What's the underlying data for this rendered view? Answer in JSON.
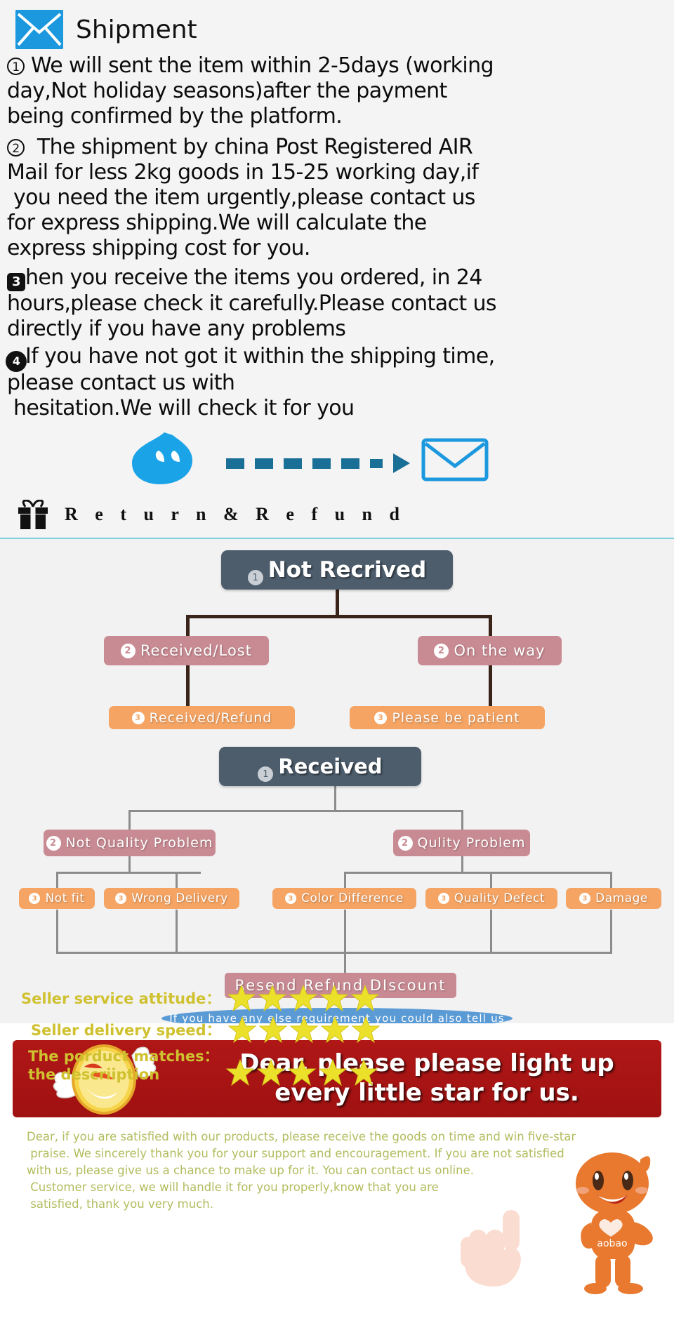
{
  "shipment": {
    "icon": "mail-icon",
    "title": "Shipment",
    "items": [
      {
        "marker": "1",
        "marker_style": "circle-outline",
        "text": "We will sent the item within 2-5days (working\nday,Not holiday seasons)after the payment\nbeing confirmed by the platform."
      },
      {
        "marker": "2",
        "marker_style": "circle-outline",
        "text": "  The shipment by china Post Registered AIR\nMail for less 2kg goods in 15-25 working day,if\n you need the item urgently,please contact us\nfor express shipping.We will calculate the\nexpress shipping cost for you."
      },
      {
        "marker": "3",
        "marker_style": "filled-square",
        "text": "hen you receive the items you ordered, in 24\nhours,please check it carefully.Please contact us\ndirectly if you have any problems"
      },
      {
        "marker": "4",
        "marker_style": "filled-circle",
        "text": "If you have not got it within the shipping time,\nplease contact us with\n hesitation.We will check it for you"
      }
    ],
    "icons_row": {
      "blob": "blue-blob-face-icon",
      "arrow": "dashed-arrow-icon",
      "envelope": "envelope-outline-icon"
    }
  },
  "return_refund": {
    "icon": "gift-icon",
    "title": "R e t u r n & R e f u n d"
  },
  "flowchart": {
    "colors": {
      "level1": "#4d5d6c",
      "level2": "#c98b93",
      "level3": "#f5a463",
      "ellipse": "#5b9bd5",
      "connector_dark": "#3a2318",
      "connector_gray": "#8c8c8c"
    },
    "tree_not_received": {
      "root": {
        "badge": "1",
        "label": "Not Recrived"
      },
      "branches": [
        {
          "badge": "2",
          "label": "Received/Lost",
          "child": {
            "badge": "3",
            "label": "Received/Refund"
          }
        },
        {
          "badge": "2",
          "label": "On  the  way",
          "child": {
            "badge": "3",
            "label": "Please  be  patient"
          }
        }
      ]
    },
    "tree_received": {
      "root": {
        "badge": "1",
        "label": "Received"
      },
      "branches": [
        {
          "badge": "2",
          "label": "Not  Quality  Problem",
          "children": [
            {
              "badge": "3",
              "label": "Not  fit"
            },
            {
              "badge": "3",
              "label": "Wrong  Delivery"
            }
          ]
        },
        {
          "badge": "2",
          "label": "Qulity  Problem",
          "children": [
            {
              "badge": "3",
              "label": "Color  Difference"
            },
            {
              "badge": "3",
              "label": "Quality  Defect"
            },
            {
              "badge": "3",
              "label": "Damage"
            }
          ]
        }
      ],
      "result": "Resend  Refund  DIscount",
      "footer_note": "If  you  have  any  else  requirement  you  could  also  tell  us"
    }
  },
  "banner": {
    "background_color": "#a81414",
    "icon": "winking-angel-emoji-icon",
    "line1": "Dear, please please light up",
    "line2": "every little star for us."
  },
  "praise": {
    "text": "Dear, if you are satisfied with our products, please receive the goods on time and win five-star\n praise. We sincerely thank you for your support and encouragement. If you are not satisfied\nwith us, please give us a chance to make up for it. You can contact us online.\n Customer service, we will handle it for you properly,know that you are\n satisfied, thank you very much.",
    "color": "#b3bc5e"
  },
  "ratings": [
    {
      "label": "Seller service attitude：",
      "stars": 5
    },
    {
      "label": "Seller delivery speed：",
      "stars": 5
    },
    {
      "label": "The porduct matches：",
      "label_line2": "the descriiption",
      "stars": 5
    }
  ],
  "decorations": {
    "hand": "rock-hand-gesture-icon",
    "mascot": "taobao-mascot-icon",
    "mascot_shirt_text": "aobao"
  }
}
